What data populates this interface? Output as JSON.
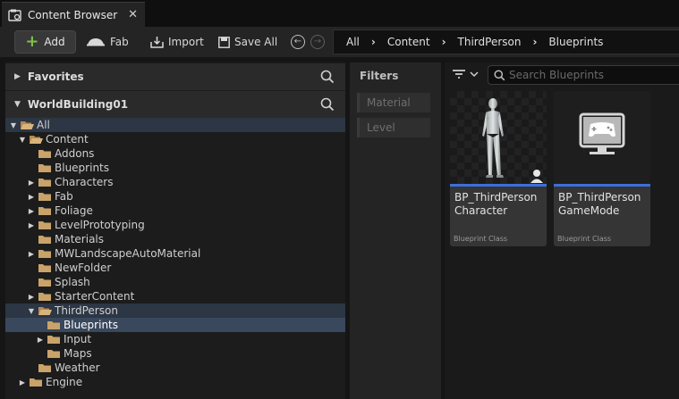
{
  "tab": {
    "title": "Content Browser",
    "close_glyph": "✕",
    "icon": "content-browser-icon"
  },
  "toolbar": {
    "add_label": "Add",
    "fab_label": "Fab",
    "import_label": "Import",
    "save_all_label": "Save All",
    "back_glyph": "←",
    "forward_glyph": "→"
  },
  "breadcrumb": [
    "All",
    "Content",
    "ThirdPerson",
    "Blueprints"
  ],
  "breadcrumb_sep": "›",
  "sections": {
    "favorites": "Favorites",
    "worldbuilding": "WorldBuilding01"
  },
  "tree": [
    {
      "label": "All",
      "depth": 0,
      "arrow": "▼",
      "open": true
    },
    {
      "label": "Content",
      "depth": 1,
      "arrow": "▼",
      "open": true
    },
    {
      "label": "Addons",
      "depth": 2,
      "arrow": ""
    },
    {
      "label": "Blueprints",
      "depth": 2,
      "arrow": ""
    },
    {
      "label": "Characters",
      "depth": 2,
      "arrow": "▶"
    },
    {
      "label": "Fab",
      "depth": 2,
      "arrow": "▶"
    },
    {
      "label": "Foliage",
      "depth": 2,
      "arrow": "▶"
    },
    {
      "label": "LevelPrototyping",
      "depth": 2,
      "arrow": "▶"
    },
    {
      "label": "Materials",
      "depth": 2,
      "arrow": ""
    },
    {
      "label": "MWLandscapeAutoMaterial",
      "depth": 2,
      "arrow": "▶"
    },
    {
      "label": "NewFolder",
      "depth": 2,
      "arrow": ""
    },
    {
      "label": "Splash",
      "depth": 2,
      "arrow": ""
    },
    {
      "label": "StarterContent",
      "depth": 2,
      "arrow": "▶"
    },
    {
      "label": "ThirdPerson",
      "depth": 2,
      "arrow": "▼",
      "open": true
    },
    {
      "label": "Blueprints",
      "depth": 3,
      "arrow": ""
    },
    {
      "label": "Input",
      "depth": 3,
      "arrow": "▶"
    },
    {
      "label": "Maps",
      "depth": 3,
      "arrow": ""
    },
    {
      "label": "Weather",
      "depth": 2,
      "arrow": ""
    },
    {
      "label": "Engine",
      "depth": 1,
      "arrow": "▶"
    }
  ],
  "filters": {
    "title": "Filters",
    "items": [
      "Material",
      "Level"
    ]
  },
  "search": {
    "placeholder": "Search Blueprints"
  },
  "assets": [
    {
      "name": "BP_ThirdPerson Character",
      "class": "Blueprint Class",
      "icon": "character-mannequin-icon"
    },
    {
      "name": "BP_ThirdPerson GameMode",
      "class": "Blueprint Class",
      "icon": "gamepad-monitor-icon"
    }
  ],
  "colors": {
    "accent": "#3c6fd8",
    "selection": "#39485c",
    "folder": "#c9a36a",
    "add_plus": "#7fc04a"
  }
}
